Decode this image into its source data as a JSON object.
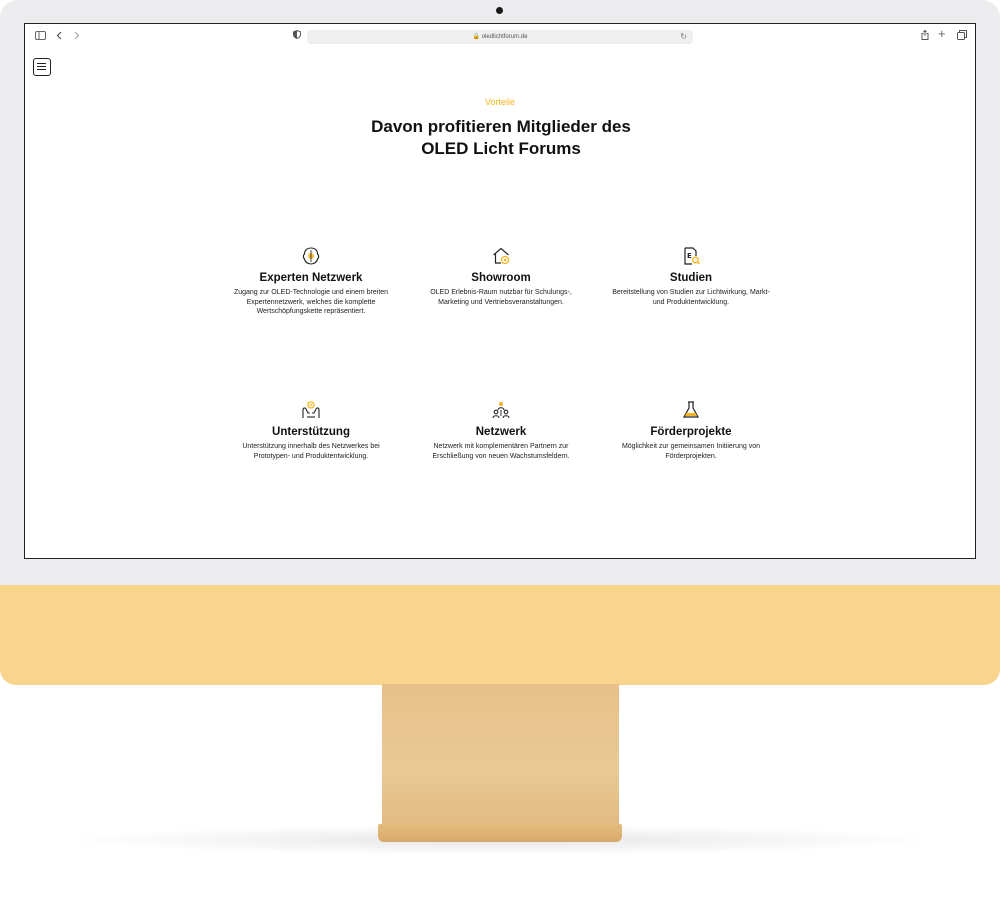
{
  "browser": {
    "url": "oledlichtforum.de"
  },
  "section": {
    "eyebrow": "Vorteile",
    "heading_line1": "Davon profitieren Mitglieder des",
    "heading_line2": "OLED Licht Forums"
  },
  "colors": {
    "accent": "#f5b31d",
    "chin": "#f8d48c",
    "stand": "#e7c08a"
  },
  "benefits": [
    {
      "icon": "brain-network-icon",
      "title": "Experten Netzwerk",
      "desc": "Zugang zur OLED-Technologie und einem breiten Expertennetzwerk, welches die komplette Wertschöpfungskette repräsentiert."
    },
    {
      "icon": "house-showroom-icon",
      "title": "Showroom",
      "desc": "OLED Erlebnis-Raum nutzbar für Schulungs-, Marketing und Vertriebsveranstaltungen."
    },
    {
      "icon": "document-search-icon",
      "title": "Studien",
      "desc": "Bereitstellung von Studien zur Lichtwirkung, Markt- und Produktentwicklung."
    },
    {
      "icon": "helping-hands-icon",
      "title": "Unterstützung",
      "desc": "Unterstützung innerhalb des Netzwerkes bei Prototypen- und Produktentwicklung."
    },
    {
      "icon": "people-network-icon",
      "title": "Netzwerk",
      "desc": "Netzwerk mit komplementären Partnern zur Erschließung von neuen Wachstumsfeldern."
    },
    {
      "icon": "flask-icon",
      "title": "Förderprojekte",
      "desc": "Möglichkeit zur gemeinsamen Initiierung von Förderprojekten."
    }
  ]
}
